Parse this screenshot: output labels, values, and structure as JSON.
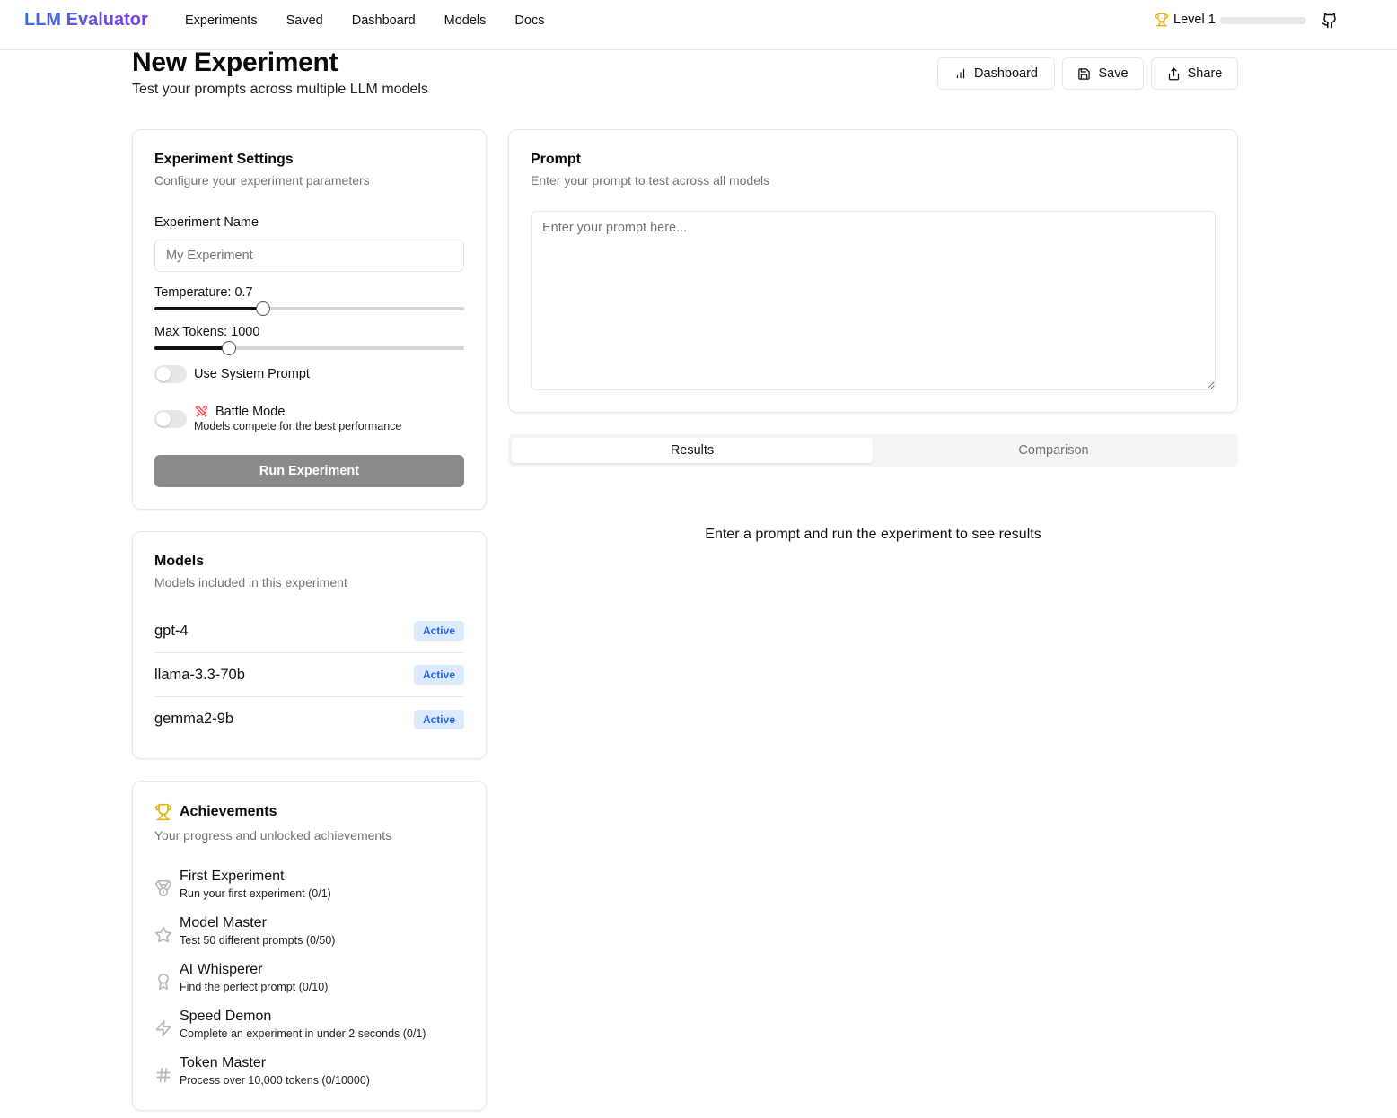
{
  "nav": {
    "brand": "LLM Evaluator",
    "links": [
      "Experiments",
      "Saved",
      "Dashboard",
      "Models",
      "Docs"
    ],
    "level_label": "Level 1",
    "level_progress": 0,
    "trophy_icon": "trophy-icon",
    "github_icon": "github-icon"
  },
  "header": {
    "title": "New Experiment",
    "subtitle": "Test your prompts across multiple LLM models",
    "buttons": {
      "dashboard": "Dashboard",
      "save": "Save",
      "share": "Share"
    }
  },
  "settings": {
    "title": "Experiment Settings",
    "description": "Configure your experiment parameters",
    "name_label": "Experiment Name",
    "name_placeholder": "My Experiment",
    "name_value": "",
    "temperature_label": "Temperature: 0.7",
    "temperature_value": 0.7,
    "temperature_fraction": 0.35,
    "max_tokens_label": "Max Tokens: 1000",
    "max_tokens_value": 1000,
    "max_tokens_fraction": 0.24,
    "system_prompt_label": "Use System Prompt",
    "system_prompt_on": false,
    "battle_mode_label": "Battle Mode",
    "battle_mode_desc": "Models compete for the best performance",
    "battle_mode_on": false,
    "run_button": "Run Experiment"
  },
  "models": {
    "title": "Models",
    "description": "Models included in this experiment",
    "items": [
      {
        "name": "gpt-4",
        "status": "Active"
      },
      {
        "name": "llama-3.3-70b",
        "status": "Active"
      },
      {
        "name": "gemma2-9b",
        "status": "Active"
      }
    ]
  },
  "achievements": {
    "title": "Achievements",
    "description": "Your progress and unlocked achievements",
    "items": [
      {
        "title": "First Experiment",
        "desc": "Run your first experiment (0/1)",
        "icon": "medal-icon"
      },
      {
        "title": "Model Master",
        "desc": "Test 50 different prompts (0/50)",
        "icon": "star-icon"
      },
      {
        "title": "AI Whisperer",
        "desc": "Find the perfect prompt (0/10)",
        "icon": "award-icon"
      },
      {
        "title": "Speed Demon",
        "desc": "Complete an experiment in under 2 seconds (0/1)",
        "icon": "zap-icon"
      },
      {
        "title": "Token Master",
        "desc": "Process over 10,000 tokens (0/10000)",
        "icon": "hash-icon"
      }
    ]
  },
  "prompt": {
    "title": "Prompt",
    "description": "Enter your prompt to test across all models",
    "placeholder": "Enter your prompt here..."
  },
  "tabs": {
    "results": "Results",
    "comparison": "Comparison",
    "active": "Results"
  },
  "empty_message": "Enter a prompt and run the experiment to see results",
  "colors": {
    "brand_start": "#3b6fe0",
    "brand_end": "#7c3aed",
    "trophy": "#eab308",
    "badge_text": "#2563eb",
    "badge_bg": "#dbeafe",
    "run_button_bg": "#8a8a8a",
    "battle_icon": "#ef4444"
  }
}
